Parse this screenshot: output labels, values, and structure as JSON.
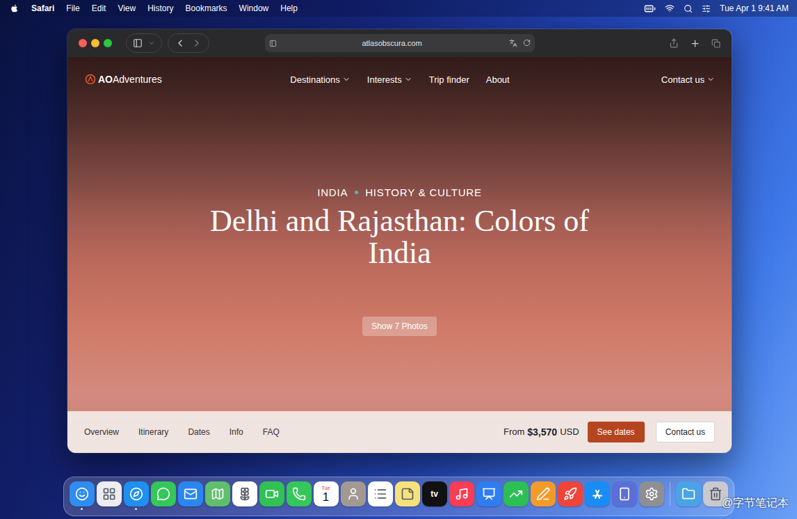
{
  "menu_bar": {
    "app": "Safari",
    "menus": [
      "File",
      "Edit",
      "View",
      "History",
      "Bookmarks",
      "Window",
      "Help"
    ],
    "clock": "Tue Apr 1 9:41 AM"
  },
  "browser": {
    "address": "atlasobscura.com"
  },
  "page": {
    "logo": {
      "mark": "AO",
      "text": "Adventures"
    },
    "nav": [
      {
        "label": "Destinations",
        "dropdown": true
      },
      {
        "label": "Interests",
        "dropdown": true
      },
      {
        "label": "Trip finder",
        "dropdown": false
      },
      {
        "label": "About",
        "dropdown": false
      }
    ],
    "contact": {
      "label": "Contact us",
      "dropdown": true
    },
    "hero": {
      "tags": [
        "INDIA",
        "HISTORY & CULTURE"
      ],
      "title": "Delhi and Rajasthan: Colors of India",
      "photos_button": "Show 7 Photos"
    },
    "subnav": [
      "Overview",
      "Itinerary",
      "Dates",
      "Info",
      "FAQ"
    ],
    "price": {
      "prefix": "From",
      "amount": "$3,570",
      "currency": "USD"
    },
    "buttons": [
      {
        "label": "See dates",
        "kind": "primary"
      },
      {
        "label": "Contact us",
        "kind": "secondary"
      }
    ]
  },
  "dock": {
    "apps": [
      {
        "kind": "finder",
        "color": "#2f8cf0",
        "running": true
      },
      {
        "kind": "launchpad",
        "color": "#ececf1",
        "running": false
      },
      {
        "kind": "safari",
        "color": "#1f8ff0",
        "running": true
      },
      {
        "kind": "messages",
        "color": "#34c759",
        "running": false
      },
      {
        "kind": "mail",
        "color": "#2a86f0",
        "running": false
      },
      {
        "kind": "maps",
        "color": "#5fbf6a",
        "running": false
      },
      {
        "kind": "photos",
        "color": "#ffffff",
        "running": false
      },
      {
        "kind": "facetime",
        "color": "#30c254",
        "running": false
      },
      {
        "kind": "phone",
        "color": "#34c759",
        "running": false
      },
      {
        "kind": "calendar",
        "color": "#ffffff",
        "running": false,
        "label": "Tue",
        "day": "1"
      },
      {
        "kind": "contacts",
        "color": "#a29a92",
        "running": false
      },
      {
        "kind": "reminders",
        "color": "#ffffff",
        "running": false
      },
      {
        "kind": "notes",
        "color": "#f7e27a",
        "running": false
      },
      {
        "kind": "tv",
        "color": "#111111",
        "running": false,
        "label": "tv"
      },
      {
        "kind": "music",
        "color": "#fa3c55",
        "running": false
      },
      {
        "kind": "keynote",
        "color": "#2f7df0",
        "running": false
      },
      {
        "kind": "numbers",
        "color": "#2bbf55",
        "running": false
      },
      {
        "kind": "pages",
        "color": "#f39a2b",
        "running": false
      },
      {
        "kind": "rocket",
        "color": "#f0443a",
        "running": false
      },
      {
        "kind": "appstore",
        "color": "#1a8cf5",
        "running": false
      },
      {
        "kind": "iphone",
        "color": "#5a6fd8",
        "running": false
      },
      {
        "kind": "settings",
        "color": "#8e8e93",
        "running": false
      },
      {
        "kind": "separator",
        "color": "#ffffff",
        "running": false
      },
      {
        "kind": "downloads",
        "color": "#4aa3e6",
        "running": false
      },
      {
        "kind": "trash",
        "color": "#c9c9cf",
        "running": false
      }
    ]
  },
  "watermark": "@字节笔记本"
}
